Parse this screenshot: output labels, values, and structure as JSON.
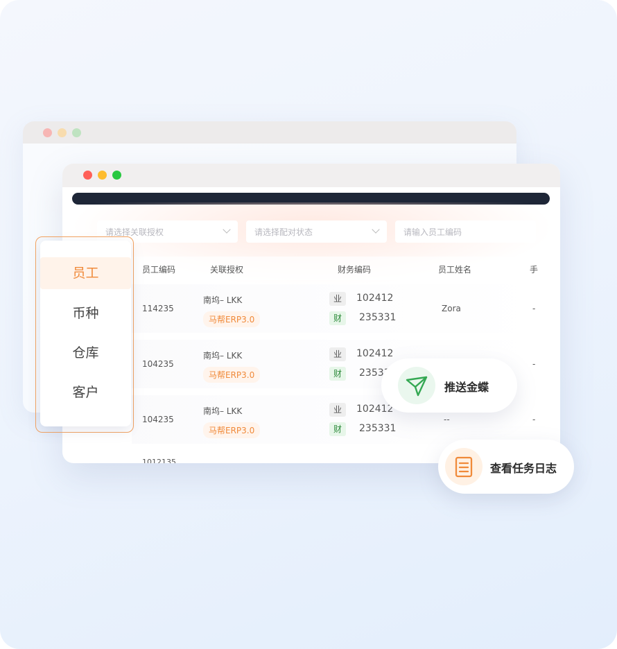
{
  "window_dots": {
    "red": "#ff5f57",
    "yellow": "#febc2e",
    "green": "#28c840"
  },
  "filters": [
    {
      "placeholder": "请选择关联授权"
    },
    {
      "placeholder": "请选择配对状态"
    },
    {
      "placeholder": "请输入员工编码"
    }
  ],
  "columns": [
    "员工编码",
    "关联授权",
    "财务编码",
    "员工姓名",
    "手"
  ],
  "rows": [
    {
      "code": "114235",
      "auth": "南坞– LKK",
      "erp": "马帮ERP3.0",
      "ye_label": "业",
      "ye_num": "102412",
      "cai_label": "财",
      "cai_num": "235331",
      "name": "Zora",
      "extra": "-"
    },
    {
      "code": "104235",
      "auth": "南坞– LKK",
      "erp": "马帮ERP3.0",
      "ye_label": "业",
      "ye_num": "102412",
      "cai_label": "财",
      "cai_num": "23533",
      "name": "",
      "extra": "-"
    },
    {
      "code": "104235",
      "auth": "南坞– LKK",
      "erp": "马帮ERP3.0",
      "ye_label": "业",
      "ye_num": "102412",
      "cai_label": "财",
      "cai_num": "235331",
      "name": "--",
      "extra": "-"
    },
    {
      "code": "1012135"
    }
  ],
  "menu": {
    "items": [
      "员工",
      "币种",
      "仓库",
      "客户"
    ],
    "active": "员工"
  },
  "actions": {
    "push_label": "推送金蝶",
    "log_label": "查看任务日志"
  },
  "colors": {
    "accent": "#f08a3a",
    "green": "#34a853",
    "navbar": "#1e2637"
  }
}
